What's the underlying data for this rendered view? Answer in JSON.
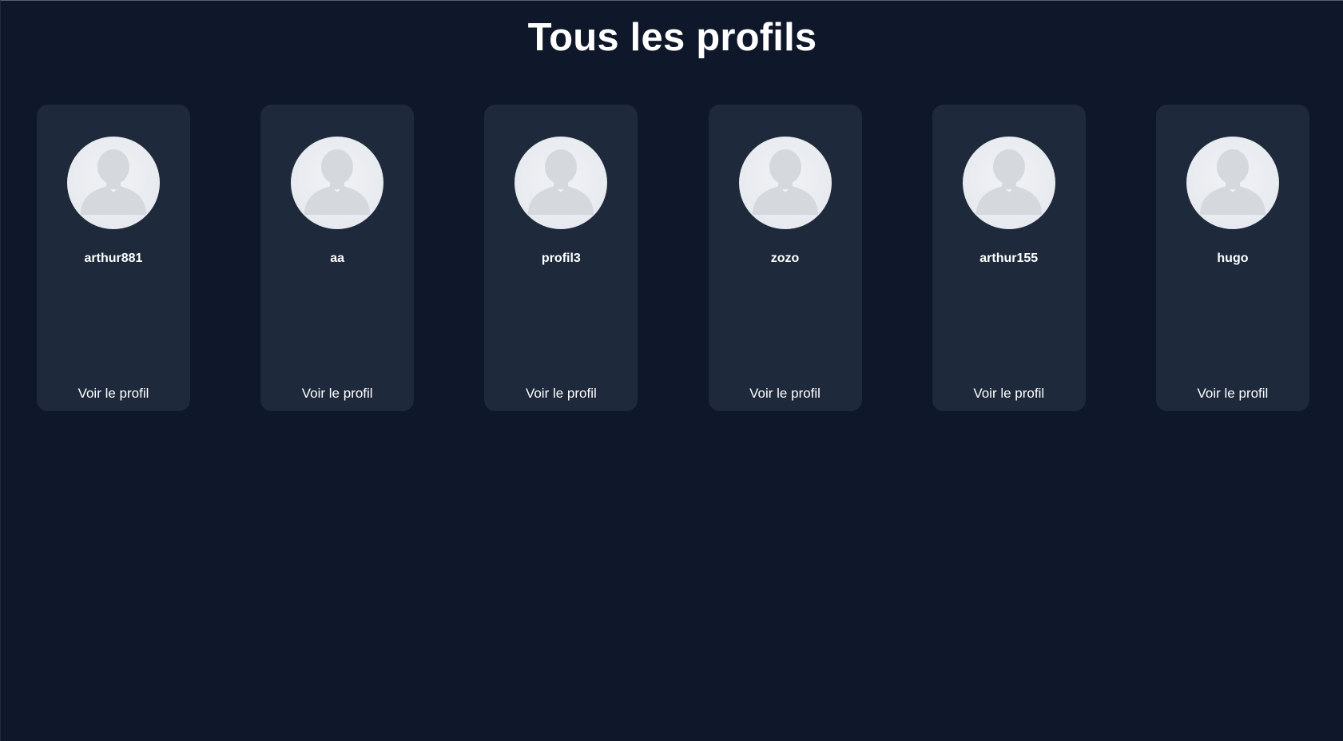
{
  "page": {
    "title": "Tous les profils"
  },
  "colors": {
    "background": "#0f172a",
    "card": "#1e293b",
    "avatar_bg": "#eceff3",
    "avatar_silhouette": "#d5d9de",
    "text": "#ffffff"
  },
  "profiles": [
    {
      "username": "arthur881",
      "link_label": "Voir le profil",
      "avatar_icon": "default-user-icon"
    },
    {
      "username": "aa",
      "link_label": "Voir le profil",
      "avatar_icon": "default-user-icon"
    },
    {
      "username": "profil3",
      "link_label": "Voir le profil",
      "avatar_icon": "default-user-icon"
    },
    {
      "username": "zozo",
      "link_label": "Voir le profil",
      "avatar_icon": "default-user-icon"
    },
    {
      "username": "arthur155",
      "link_label": "Voir le profil",
      "avatar_icon": "default-user-icon"
    },
    {
      "username": "hugo",
      "link_label": "Voir le profil",
      "avatar_icon": "default-user-icon"
    }
  ]
}
